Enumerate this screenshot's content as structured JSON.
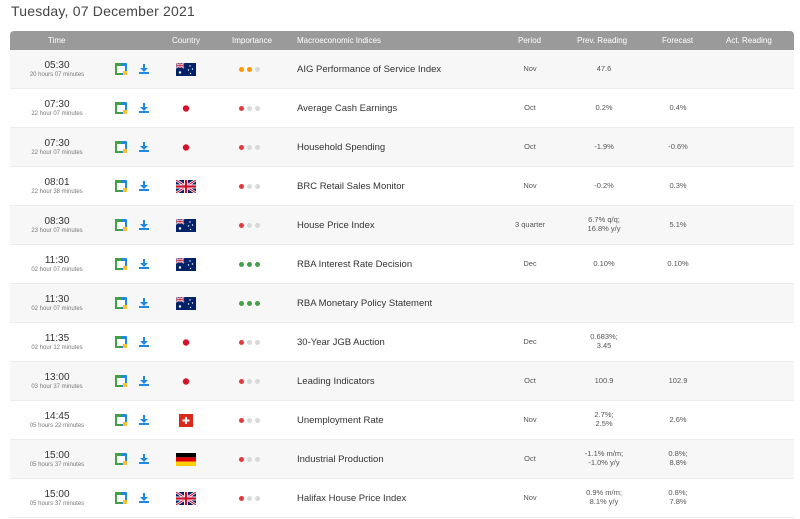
{
  "date_title": "Tuesday, 07 December 2021",
  "headers": {
    "time": "Time",
    "country": "Country",
    "importance": "Importance",
    "indicators": "Macroeconomic Indices",
    "period": "Period",
    "prev": "Prev. Reading",
    "forecast": "Forecast",
    "actual": "Act. Reading"
  },
  "colors": {
    "header_bg": "#9a9a9a",
    "importance_red": "#e53935",
    "importance_orange": "#ff9800",
    "importance_green": "#43a047",
    "importance_inactive": "#d9d9d9",
    "icon_blue": "#1e88e5"
  },
  "events": [
    {
      "time": "05:30",
      "countdown": "20 hours 07 minutes",
      "country_flag": "australia-flag",
      "importance": 2,
      "importance_color": "orange",
      "indicator": "AIG Performance of Service Index",
      "period": "Nov",
      "prev": "47.6",
      "forecast": "",
      "actual": ""
    },
    {
      "time": "07:30",
      "countdown": "22 hour 07 minutes",
      "country_flag": "japan-flag",
      "importance": 1,
      "importance_color": "red",
      "indicator": "Average Cash Earnings",
      "period": "Oct",
      "prev": "0.2%",
      "forecast": "0.4%",
      "actual": ""
    },
    {
      "time": "07:30",
      "countdown": "22 hour 07 minutes",
      "country_flag": "japan-flag",
      "importance": 1,
      "importance_color": "red",
      "indicator": "Household Spending",
      "period": "Oct",
      "prev": "-1.9%",
      "forecast": "-0.6%",
      "actual": ""
    },
    {
      "time": "08:01",
      "countdown": "22 hour 38 minutes",
      "country_flag": "uk-flag",
      "importance": 1,
      "importance_color": "red",
      "indicator": "BRC Retail Sales Monitor",
      "period": "Nov",
      "prev": "-0.2%",
      "forecast": "0.3%",
      "actual": ""
    },
    {
      "time": "08:30",
      "countdown": "23 hour 07 minutes",
      "country_flag": "australia-flag",
      "importance": 1,
      "importance_color": "red",
      "indicator": "House Price Index",
      "period": "3 quarter",
      "prev": "6.7% q/q;\n16.8% y/y",
      "forecast": "5.1%",
      "actual": ""
    },
    {
      "time": "11:30",
      "countdown": "02 hour 07 minutes",
      "country_flag": "australia-flag",
      "importance": 3,
      "importance_color": "green",
      "indicator": "RBA Interest Rate Decision",
      "period": "Dec",
      "prev": "0.10%",
      "forecast": "0.10%",
      "actual": ""
    },
    {
      "time": "11:30",
      "countdown": "02 hour 07 minutes",
      "country_flag": "australia-flag",
      "importance": 3,
      "importance_color": "green",
      "indicator": "RBA Monetary Policy Statement",
      "period": "",
      "prev": "",
      "forecast": "",
      "actual": ""
    },
    {
      "time": "11:35",
      "countdown": "02 hour 12 minutes",
      "country_flag": "japan-flag",
      "importance": 1,
      "importance_color": "red",
      "indicator": "30-Year JGB Auction",
      "period": "Dec",
      "prev": "0.683%;\n3.45",
      "forecast": "",
      "actual": ""
    },
    {
      "time": "13:00",
      "countdown": "03 hour 37 minutes",
      "country_flag": "japan-flag",
      "importance": 1,
      "importance_color": "red",
      "indicator": "Leading Indicators",
      "period": "Oct",
      "prev": "100.9",
      "forecast": "102.9",
      "actual": ""
    },
    {
      "time": "14:45",
      "countdown": "05 hours 22 minutes",
      "country_flag": "switzerland-flag",
      "importance": 1,
      "importance_color": "red",
      "indicator": "Unemployment Rate",
      "period": "Nov",
      "prev": "2.7%;\n2.5%",
      "forecast": "2.6%",
      "actual": ""
    },
    {
      "time": "15:00",
      "countdown": "05 hours 37 minutes",
      "country_flag": "germany-flag",
      "importance": 1,
      "importance_color": "red",
      "indicator": "Industrial Production",
      "period": "Oct",
      "prev": "-1.1% m/m;\n-1.0% y/y",
      "forecast": "0.8%;\n8.8%",
      "actual": ""
    },
    {
      "time": "15:00",
      "countdown": "05 hours 37 minutes",
      "country_flag": "uk-flag",
      "importance": 1,
      "importance_color": "red",
      "indicator": "Halifax House Price Index",
      "period": "Nov",
      "prev": "0.9% m/m;\n8.1% y/y",
      "forecast": "0.8%;\n7.8%",
      "actual": ""
    }
  ]
}
